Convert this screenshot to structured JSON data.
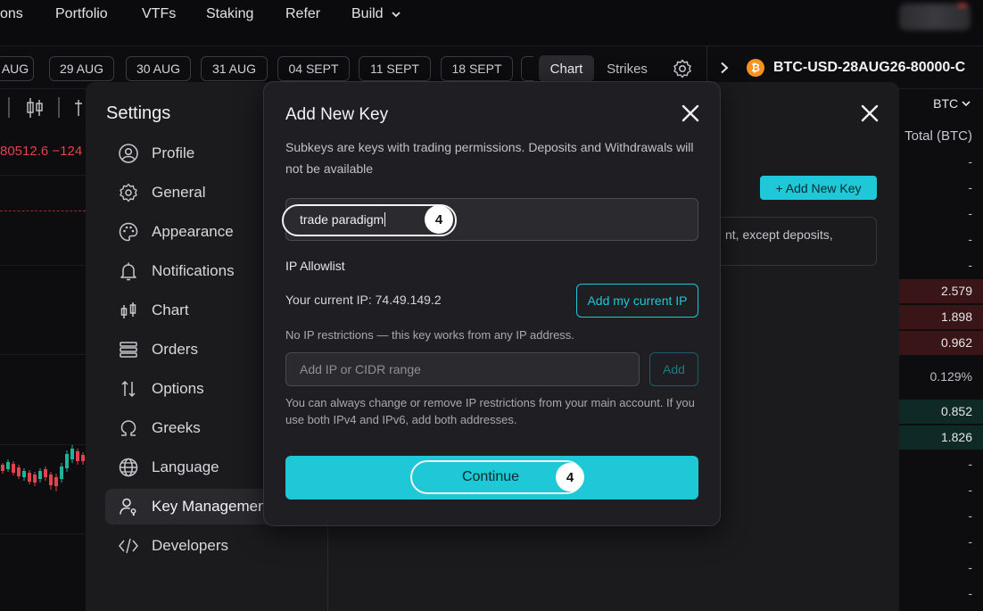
{
  "nav": {
    "items": [
      "ons",
      "Portfolio",
      "VTFs",
      "Staking",
      "Refer",
      "Build"
    ]
  },
  "dates": [
    "AUG",
    "29 AUG",
    "30 AUG",
    "31 AUG",
    "04 SEPT",
    "11 SEPT",
    "18 SEPT"
  ],
  "view_tabs": {
    "chart": "Chart",
    "strikes": "Strikes"
  },
  "instrument": {
    "name": "BTC-USD-28AUG26-80000-C",
    "coin_glyph": "₿"
  },
  "chart": {
    "price_label": "80512.6 −124"
  },
  "book": {
    "currency": "BTC",
    "header": "Total (BTC)",
    "rows": [
      {
        "value": "-",
        "kind": "plain"
      },
      {
        "value": "-",
        "kind": "plain"
      },
      {
        "value": "-",
        "kind": "plain"
      },
      {
        "value": "-",
        "kind": "plain"
      },
      {
        "value": "-",
        "kind": "plain"
      },
      {
        "value": "2.579",
        "kind": "red"
      },
      {
        "value": "1.898",
        "kind": "red"
      },
      {
        "value": "0.962",
        "kind": "red"
      },
      {
        "value": "0.129%",
        "kind": "plain"
      },
      {
        "value": "0.852",
        "kind": "green"
      },
      {
        "value": "1.826",
        "kind": "green"
      },
      {
        "value": "-",
        "kind": "plain"
      },
      {
        "value": "-",
        "kind": "plain"
      },
      {
        "value": "-",
        "kind": "plain"
      },
      {
        "value": "-",
        "kind": "plain"
      },
      {
        "value": "-",
        "kind": "plain"
      },
      {
        "value": "-",
        "kind": "plain"
      }
    ]
  },
  "settings": {
    "title": "Settings",
    "items": [
      {
        "label": "Profile",
        "icon": "user-icon"
      },
      {
        "label": "General",
        "icon": "gear-icon"
      },
      {
        "label": "Appearance",
        "icon": "palette-icon"
      },
      {
        "label": "Notifications",
        "icon": "bell-icon"
      },
      {
        "label": "Chart",
        "icon": "candlestick-icon"
      },
      {
        "label": "Orders",
        "icon": "list-icon"
      },
      {
        "label": "Options",
        "icon": "up-down-arrows-icon"
      },
      {
        "label": "Greeks",
        "icon": "omega-icon"
      },
      {
        "label": "Language",
        "icon": "globe-icon"
      },
      {
        "label": "Key Management",
        "icon": "user-key-icon"
      },
      {
        "label": "Developers",
        "icon": "code-icon"
      }
    ],
    "active_index": 9,
    "add_key_label": "+ Add New Key",
    "info_text": "nt, except deposits,"
  },
  "modal": {
    "title": "Add New Key",
    "description": "Subkeys are keys with trading permissions. Deposits and Withdrawals will not be available",
    "name_value": "trade paradigm",
    "step_badge": "4",
    "ip_section_title": "IP Allowlist",
    "current_ip_text": "Your current IP: 74.49.149.2",
    "add_current_ip_label": "Add my current IP",
    "no_restrictions_text": "No IP restrictions — this key works from any IP address.",
    "cidr_placeholder": "Add IP or CIDR range",
    "add_label": "Add",
    "note": "You can always change or remove IP restrictions from your main account. If you use both IPv4 and IPv6, add both addresses.",
    "continue_label": "Continue",
    "continue_badge": "4"
  },
  "colors": {
    "accent": "#1ec8d6",
    "sell": "#e0424e",
    "coin": "#f7931a"
  }
}
